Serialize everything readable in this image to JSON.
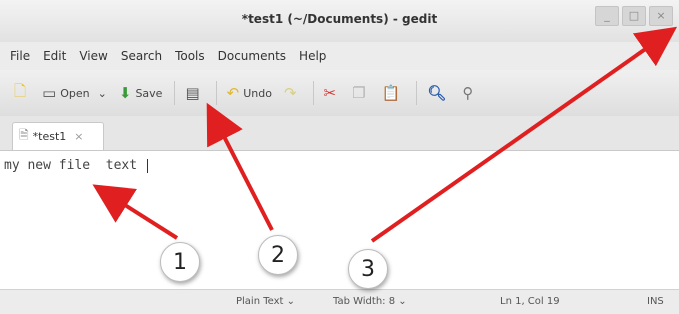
{
  "window": {
    "title": "*test1 (~/Documents) - gedit",
    "minimize_label": "_",
    "maximize_label": "□",
    "close_label": "×"
  },
  "menu": [
    "File",
    "Edit",
    "View",
    "Search",
    "Tools",
    "Documents",
    "Help"
  ],
  "toolbar": {
    "open_label": "Open",
    "open_dropdown": "⌄",
    "save_label": "Save",
    "undo_label": "Undo"
  },
  "tab": {
    "label": "*test1",
    "close": "×"
  },
  "editor": {
    "text": "my new file  text "
  },
  "statusbar": {
    "language": "Plain Text ⌄",
    "tab_width": "Tab Width: 8 ⌄",
    "position": "Ln 1, Col 19",
    "mode": "INS"
  },
  "callouts": [
    "1",
    "2",
    "3"
  ],
  "annotation_color": "#e02020"
}
